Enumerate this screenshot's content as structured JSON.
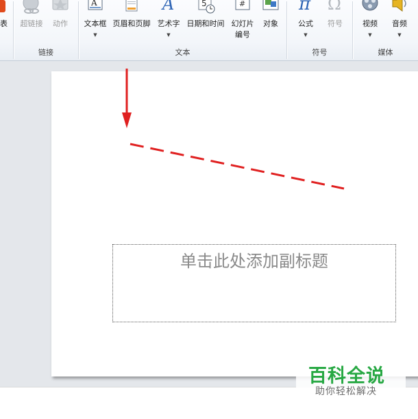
{
  "ribbon": {
    "groups": {
      "links": {
        "label": "链接",
        "buttons": {
          "hyperlink": "超链接",
          "action": "动作"
        }
      },
      "text": {
        "label": "文本",
        "buttons": {
          "textbox": "文本框",
          "header_footer": "页眉和页脚",
          "wordart": "艺术字",
          "datetime": "日期和时间",
          "slide_number_line1": "幻灯片",
          "slide_number_line2": "编号",
          "object": "对象"
        }
      },
      "symbols": {
        "label": "符号",
        "buttons": {
          "equation": "公式",
          "symbol": "符号"
        }
      },
      "media": {
        "label": "媒体",
        "buttons": {
          "video": "视频",
          "audio": "音频"
        }
      }
    },
    "cut_label": "表"
  },
  "slide": {
    "subtitle_placeholder": "单击此处添加副标题"
  },
  "annotation_color": "#e02020",
  "watermark": {
    "line1": "百科全说",
    "line2": "助你轻松解决"
  }
}
